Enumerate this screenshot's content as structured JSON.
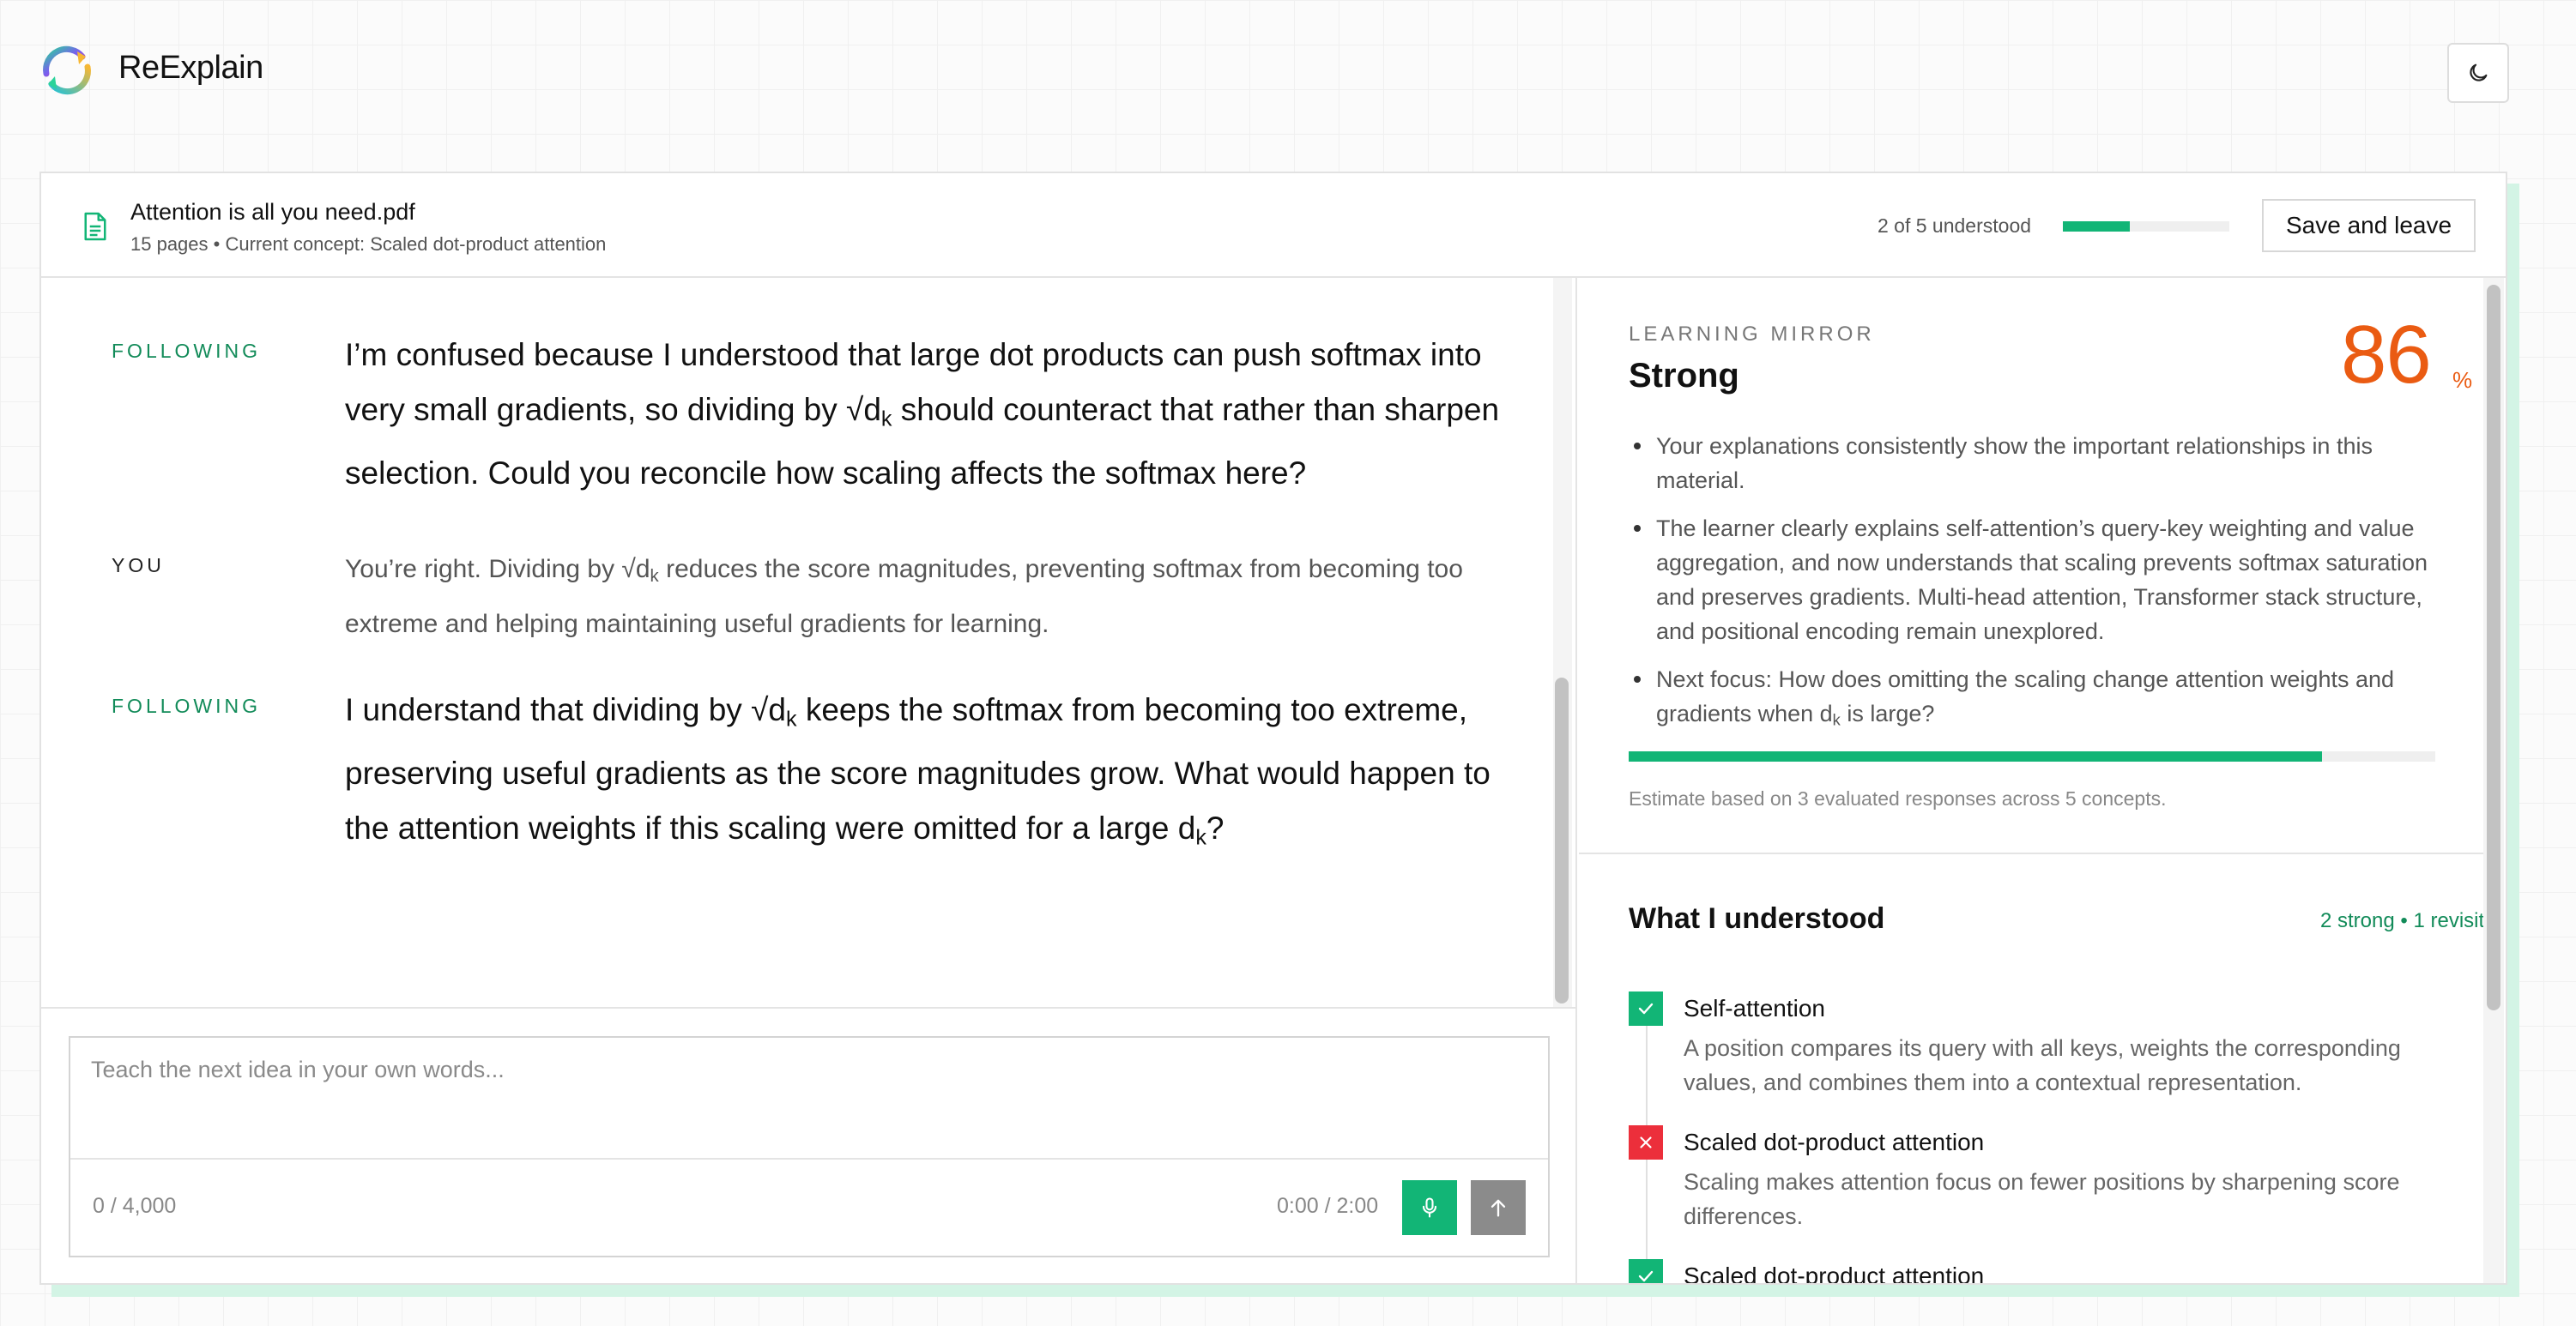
{
  "app": {
    "name": "ReExplain",
    "theme_icon": "moon-icon"
  },
  "document": {
    "title": "Attention is all you need.pdf",
    "subtitle": "15 pages • Current concept: Scaled dot-product attention",
    "progress_label": "2 of 5 understood",
    "progress_fraction": 0.4,
    "save_label": "Save and leave"
  },
  "chat": {
    "messages": [
      {
        "role": "FOLLOWING",
        "pre": "I’m confused because I understood that large dot products can push softmax into very small gradients, so dividing by √d",
        "sub": "k",
        "post": " should counteract that rather than sharpen selection. Could you reconcile how scaling affects the softmax here?"
      },
      {
        "role": "YOU",
        "pre": "You’re right. Dividing by √d",
        "sub": "k",
        "post": " reduces the score magnitudes, preventing softmax from becoming too extreme and helping maintaining useful gradients for learning."
      },
      {
        "role": "FOLLOWING",
        "pre": "I understand that dividing by √d",
        "sub": "k",
        "mid": " keeps the softmax from becoming too extreme, preserving useful gradients as the score magnitudes grow. What would happen to the attention weights if this scaling were omitted for a large d",
        "sub2": "k",
        "post": "?"
      }
    ]
  },
  "composer": {
    "placeholder": "Teach the next idea in your own words...",
    "char_count": "0 / 4,000",
    "timer": "0:00 / 2:00",
    "mic_icon": "microphone-icon",
    "send_icon": "arrow-up-icon"
  },
  "mirror": {
    "kicker": "LEARNING MIRROR",
    "level": "Strong",
    "score": "86",
    "score_unit": "%",
    "score_fraction": 0.86,
    "bullets": [
      {
        "pre": "Your explanations consistently show the important relationships in this material."
      },
      {
        "pre": "The learner clearly explains self-attention’s query-key weighting and value aggregation, and now understands that scaling prevents softmax saturation and preserves gradients. Multi-head attention, Transformer stack structure, and positional encoding remain unexplored."
      },
      {
        "pre": "Next focus: How does omitting the scaling change attention weights and gradients when d",
        "sub": "k",
        "post": " is large?"
      }
    ],
    "note": "Estimate based on 3 evaluated responses across 5 concepts."
  },
  "understood": {
    "title": "What I understood",
    "meta": "2 strong • 1 revisit",
    "items": [
      {
        "status": "ok",
        "title": "Self-attention",
        "desc": "A position compares its query with all keys, weights the corresponding values, and combines them into a contextual representation."
      },
      {
        "status": "bad",
        "title": "Scaled dot-product attention",
        "desc": "Scaling makes attention focus on fewer positions by sharpening score differences."
      },
      {
        "status": "ok",
        "title": "Scaled dot-product attention",
        "desc": ""
      }
    ]
  },
  "colors": {
    "accent": "#12b576",
    "score": "#ea5b12",
    "error": "#ec2f3b",
    "shadow": "#d3f4e5"
  }
}
